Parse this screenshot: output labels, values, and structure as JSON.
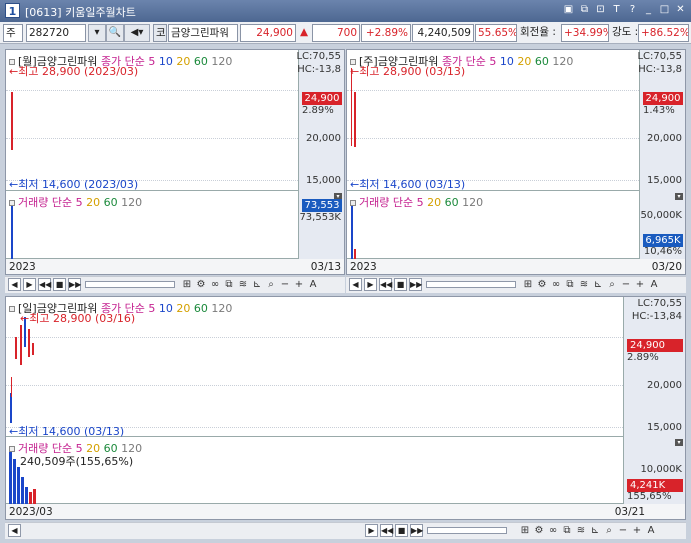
{
  "window": {
    "number": "1",
    "code": "[0613]",
    "title": "키움일주월차트",
    "icons": [
      "layout-icon",
      "copy-icon",
      "link-icon",
      "text-icon",
      "help-icon",
      "minimize-icon",
      "maximize-icon",
      "close-icon"
    ]
  },
  "toolbar": {
    "market": "주",
    "code": "282720",
    "code_badge": "코",
    "stock_name": "금양그린파워",
    "price": "24,900",
    "change": "700",
    "change_rate": "+2.89%",
    "volume": "4,240,509",
    "volume_rate": "55.65%",
    "turnover_label": "회전율 :",
    "turnover": "+34.99%",
    "strength_label": "강도 :",
    "strength": "+86.52%"
  },
  "monthly": {
    "legend_name": "[월]금양그린파워",
    "ma_label": "종가 단순",
    "ma_periods": [
      "5",
      "10",
      "20",
      "60",
      "120"
    ],
    "lc": "LC:70,55",
    "hc": "HC:-13,8",
    "high": "최고 28,900 (2023/03)",
    "low": "최저 14,600 (2023/03)",
    "price_box": "24,900",
    "rate_text": "2.89%",
    "ticks": [
      "20,000",
      "15,000"
    ],
    "vol_legend": "거래량",
    "vol_ma": "단순",
    "vol_periods": [
      "5",
      "20",
      "60",
      "120"
    ],
    "vol_box": "73,553",
    "vol_sub": "73,553K",
    "date_start": "2023",
    "date_end": "03/13"
  },
  "weekly": {
    "legend_name": "[주]금양그린파워",
    "ma_label": "종가 단순",
    "ma_periods": [
      "5",
      "10",
      "20",
      "60",
      "120"
    ],
    "lc": "LC:70,55",
    "hc": "HC:-13,8",
    "high": "최고 28,900 (03/13)",
    "low": "최저 14,600 (03/13)",
    "price_box": "24,900",
    "rate_text": "1.43%",
    "ticks": [
      "20,000",
      "15,000"
    ],
    "vol_legend": "거래량",
    "vol_ma": "단순",
    "vol_periods": [
      "5",
      "20",
      "60",
      "120"
    ],
    "vol_tick": "50,000K",
    "vol_box": "6,965K",
    "vol_sub": "10,46%",
    "date_start": "2023",
    "date_end": "03/20"
  },
  "daily": {
    "legend_name": "[일]금양그린파워",
    "ma_label": "종가 단순",
    "ma_periods": [
      "5",
      "10",
      "20",
      "60",
      "120"
    ],
    "lc": "LC:70,55",
    "hc": "HC:-13,84",
    "high": "최고 28,900 (03/16)",
    "low": "최저 14,600 (03/13)",
    "price_box": "24,900",
    "rate_text": "2.89%",
    "ticks": [
      "20,000",
      "15,000"
    ],
    "vol_legend": "거래량",
    "vol_ma": "단순",
    "vol_periods": [
      "5",
      "20",
      "60",
      "120"
    ],
    "vol_note": "240,509주(155,65%)",
    "vol_tick": "10,000K",
    "vol_box": "4,241K",
    "vol_sub": "155,65%",
    "date_start": "2023/03",
    "date_end": "03/21"
  },
  "colors": {
    "up": "#d8232a",
    "down": "#1a46c9",
    "ma5": "#c4208f",
    "ma10": "#1a46c9",
    "ma20": "#d4a000",
    "ma60": "#1c8a3c",
    "ma120": "#7a7a7a"
  }
}
